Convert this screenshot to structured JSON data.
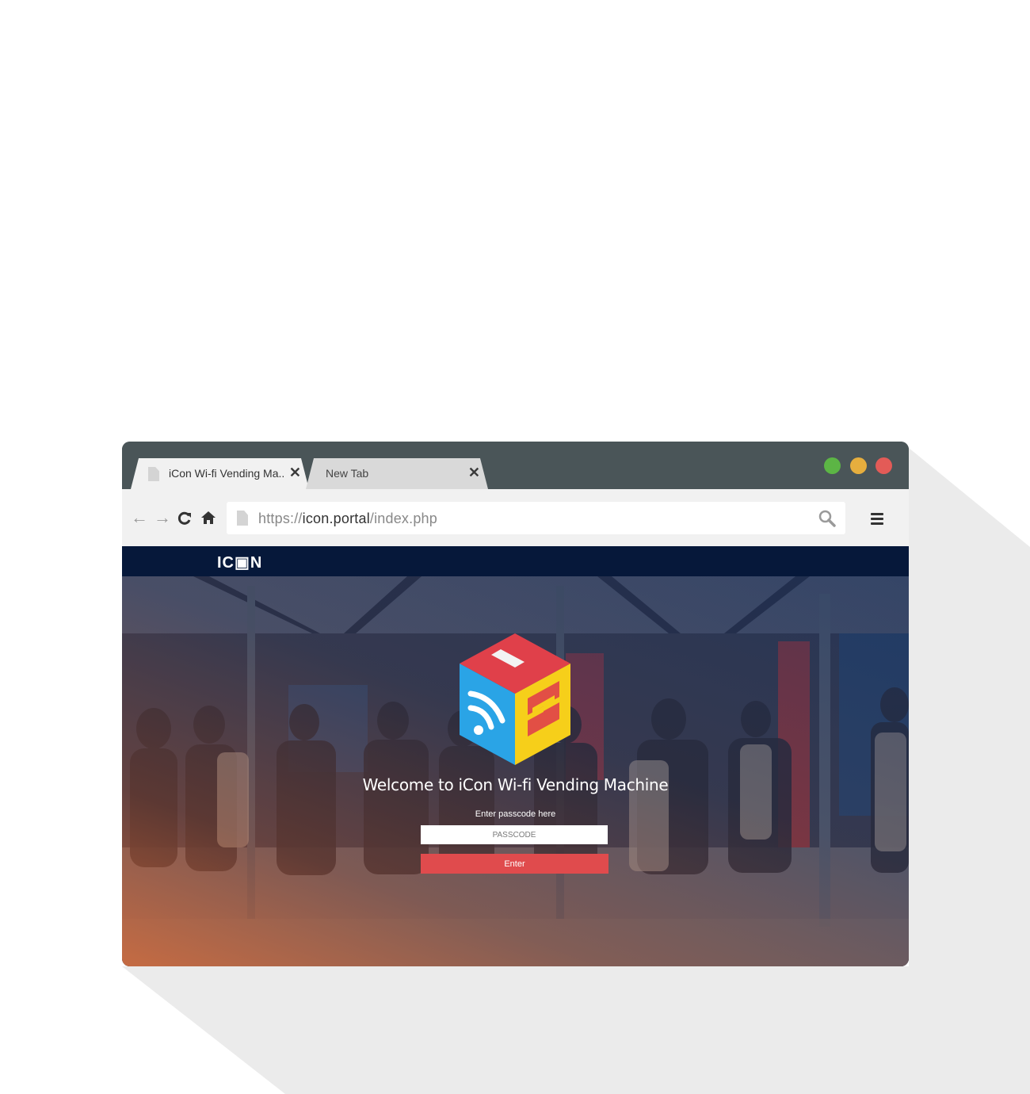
{
  "browser": {
    "tabs": [
      {
        "label": "iCon Wi-fi Vending Ma..",
        "active": true
      },
      {
        "label": "New Tab",
        "active": false
      }
    ],
    "close_glyph": "✕",
    "window_controls": [
      {
        "name": "green",
        "color": "#5cb545"
      },
      {
        "name": "yellow",
        "color": "#e6ae3e"
      },
      {
        "name": "red",
        "color": "#e35b57"
      }
    ],
    "address": {
      "scheme": "https://",
      "host": "icon.portal",
      "path": "/index.php"
    },
    "icons": {
      "back": "←",
      "forward": "→",
      "reload": "↻",
      "home": "⌂"
    }
  },
  "page": {
    "header_logo": "IC▣N",
    "welcome": "Welcome to iCon Wi-fi Vending Machine",
    "passcode_label": "Enter passcode here",
    "passcode_placeholder": "PASSCODE",
    "enter_label": "Enter",
    "colors": {
      "header": "#06183a",
      "enter_button": "#e04b4d",
      "cube_red": "#e0404a",
      "cube_blue": "#2aa4e6",
      "cube_yellow": "#f6cf1a"
    }
  }
}
